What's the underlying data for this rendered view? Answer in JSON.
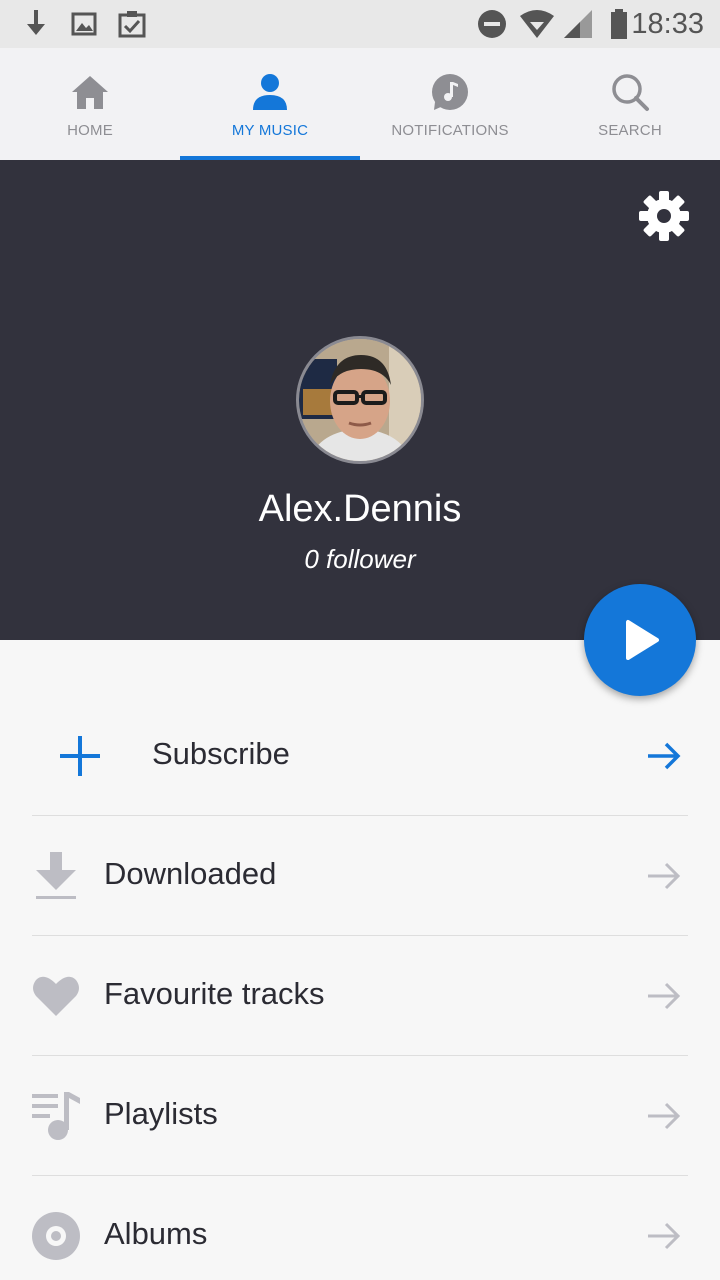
{
  "status_bar": {
    "time": "18:33",
    "icons": [
      "download-icon",
      "image-icon",
      "clipboard-check-icon",
      "do-not-disturb-icon",
      "wifi-icon",
      "signal-icon",
      "battery-icon"
    ]
  },
  "tabs": [
    {
      "label": "HOME",
      "icon": "home-icon"
    },
    {
      "label": "MY MUSIC",
      "icon": "person-icon",
      "active": true
    },
    {
      "label": "NOTIFICATIONS",
      "icon": "music-note-bubble-icon"
    },
    {
      "label": "SEARCH",
      "icon": "search-icon"
    }
  ],
  "profile": {
    "username": "Alex.Dennis",
    "followers": "0 follower"
  },
  "menu": [
    {
      "label": "Subscribe",
      "icon": "plus-icon"
    },
    {
      "label": "Downloaded",
      "icon": "download-icon"
    },
    {
      "label": "Favourite tracks",
      "icon": "heart-icon"
    },
    {
      "label": "Playlists",
      "icon": "playlist-icon"
    },
    {
      "label": "Albums",
      "icon": "album-icon"
    }
  ],
  "colors": {
    "accent": "#1477d9",
    "header_bg": "#32323d",
    "inactive_icon": "#8e8e93",
    "list_icon": "#bdbdc4"
  }
}
